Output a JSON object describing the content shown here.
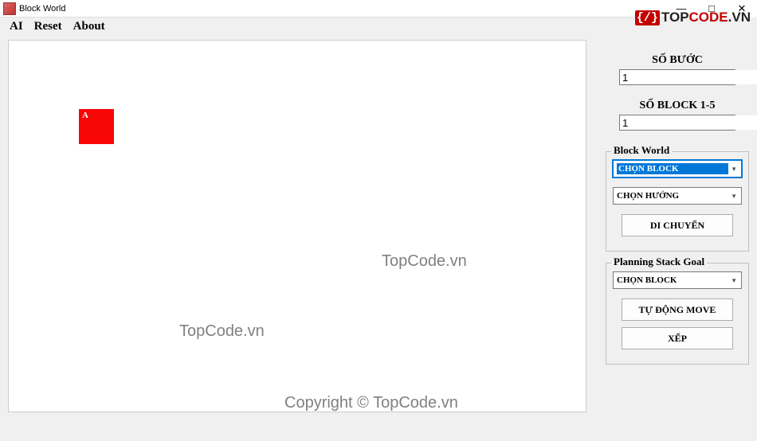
{
  "window": {
    "title": "Block World",
    "minimize": "—",
    "maximize": "□",
    "close": "✕"
  },
  "menu": {
    "ai": "AI",
    "reset": "Reset",
    "about": "About"
  },
  "block": {
    "a_label": "A"
  },
  "watermarks": {
    "wm1": "TopCode.vn",
    "wm2": "TopCode.vn",
    "wm3": "Copyright © TopCode.vn"
  },
  "panel": {
    "steps_label": "SỐ BƯỚC",
    "steps_value": "1",
    "blocks_label": "SỐ BLOCK 1-5",
    "blocks_value": "1"
  },
  "group_blockworld": {
    "title": "Block World",
    "combo_block": "CHỌN BLOCK",
    "combo_dir": "CHỌN HƯỚNG",
    "btn_move": "DI CHUYỂN"
  },
  "group_planning": {
    "title": "Planning Stack Goal",
    "combo_block": "CHỌN BLOCK",
    "btn_auto": "TỰ ĐỘNG MOVE",
    "btn_stack": "XẾP"
  },
  "brand": {
    "bracket": "{/}",
    "top": "TOP",
    "code": "CODE",
    "vn": ".VN"
  }
}
